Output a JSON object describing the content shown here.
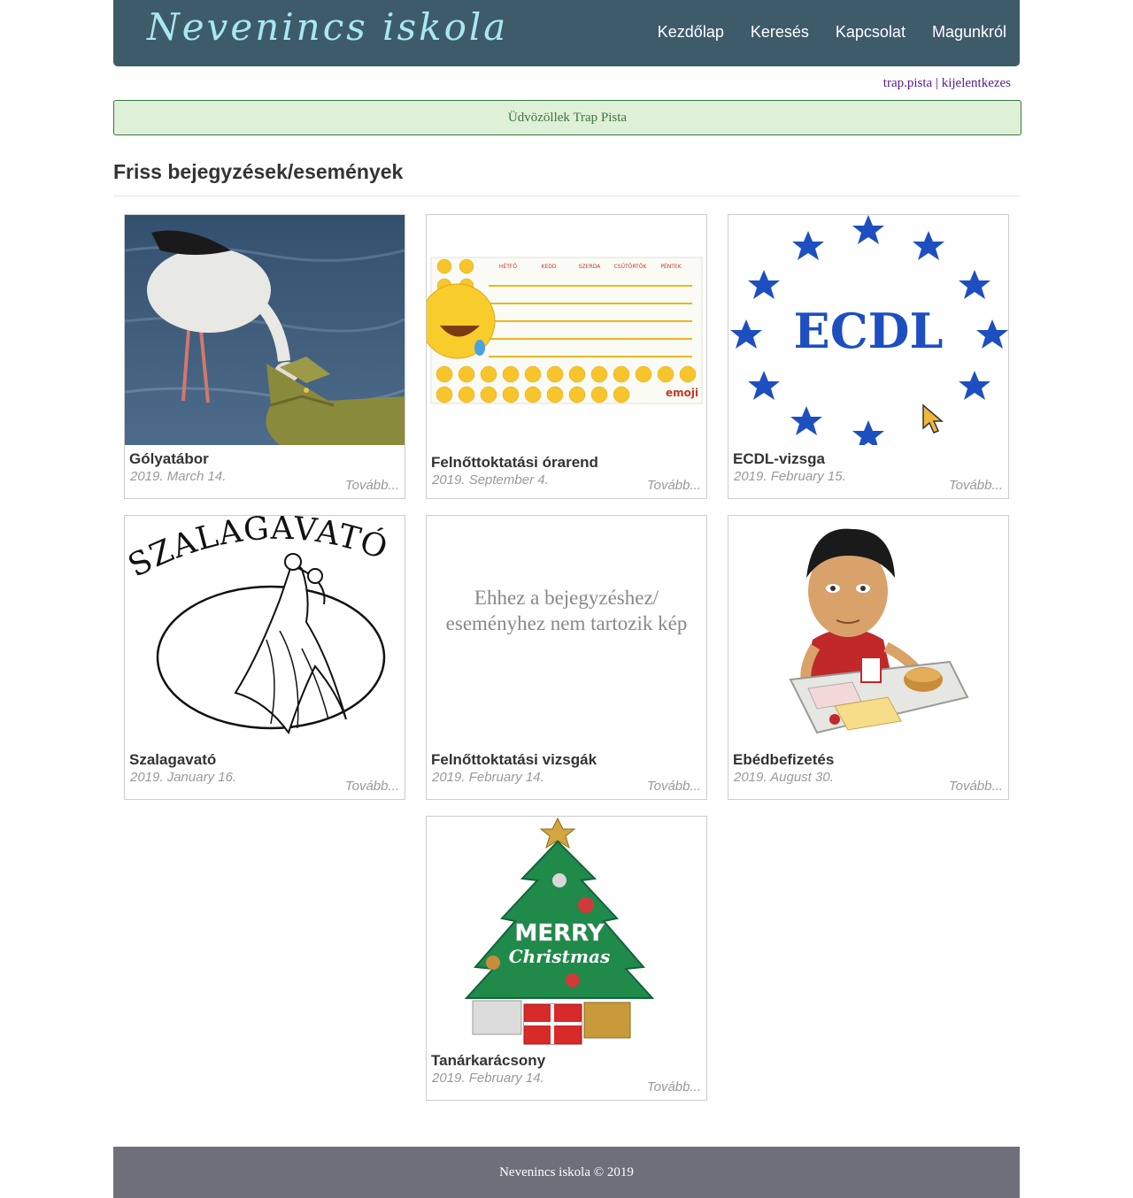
{
  "header": {
    "brand": "Nevenincs iskola",
    "nav": [
      "Kezdőlap",
      "Keresés",
      "Kapcsolat",
      "Magunkról"
    ]
  },
  "user": {
    "username": "trap.pista",
    "separator": "|",
    "logout": "kijelentkezes"
  },
  "alert": {
    "message": "Üdvözöllek Trap Pista"
  },
  "section": {
    "title": "Friss bejegyzések/események"
  },
  "posts": [
    {
      "title": "Gólyatábor",
      "date": "2019. March 14.",
      "more": "Tovább..."
    },
    {
      "title": "Felnőttoktatási órarend",
      "date": "2019. September 4.",
      "more": "Tovább...",
      "image_text": {
        "days": [
          "HÉTFŐ",
          "KEDD",
          "SZERDA",
          "CSÜTÖRTÖK",
          "PÉNTEK"
        ],
        "logo": "emoji"
      }
    },
    {
      "title": "ECDL-vizsga",
      "date": "2019. February 15.",
      "more": "Tovább...",
      "image_text": "ECDL"
    },
    {
      "title": "Szalagavató",
      "date": "2019. January 16.",
      "more": "Tovább...",
      "image_text": "SZALAGAVATÓ"
    },
    {
      "title": "Felnőttoktatási vizsgák",
      "date": "2019. February 14.",
      "more": "Tovább...",
      "no_image": "Ehhez a bejegyzéshez/ eseményhez nem tartozik kép"
    },
    {
      "title": "Ebédbefizetés",
      "date": "2019. August 30.",
      "more": "Tovább..."
    },
    {
      "title": "Tanárkarácsony",
      "date": "2019. February 14.",
      "more": "Tovább...",
      "image_text": {
        "line1": "MERRY",
        "line2": "Christmas"
      }
    }
  ],
  "footer": {
    "text": "Nevenincs iskola © 2019"
  },
  "colors": {
    "navbar": "#3e5b6a",
    "brand": "#a8e8f2",
    "alert_bg": "#dff0d8",
    "alert_text": "#3c763d",
    "footer": "#6f6f7c",
    "link": "#551a8b"
  }
}
